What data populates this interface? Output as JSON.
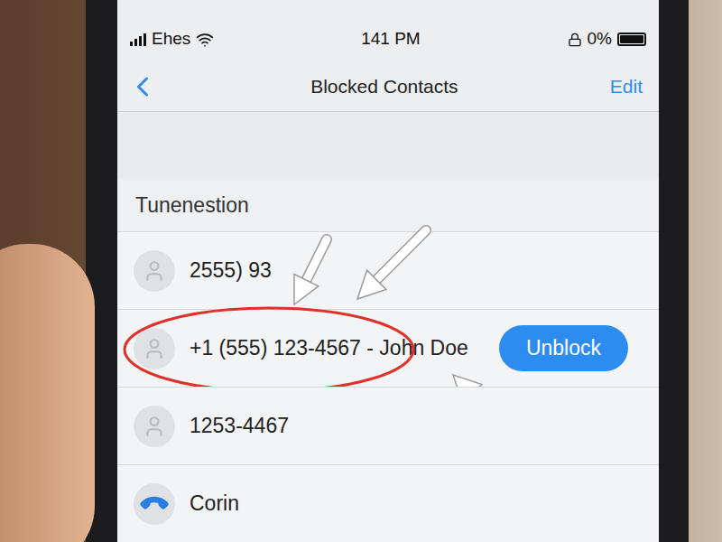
{
  "status_bar": {
    "carrier": "Ehes",
    "time": "141 PM",
    "battery": "0%",
    "battery_level": 1
  },
  "nav": {
    "title": "Blocked Contacts",
    "action": "Edit"
  },
  "section": {
    "header": "Tunenestion"
  },
  "contacts": [
    {
      "label": "2555) 93",
      "kind": "person",
      "circled": false
    },
    {
      "label": "+1 (555) 123-4567 - John Doe",
      "kind": "person",
      "circled": true,
      "button": "Unblock"
    },
    {
      "label": "1253-4467",
      "kind": "person",
      "circled": false
    },
    {
      "label": "Corin",
      "kind": "phone",
      "circled": false
    }
  ]
}
